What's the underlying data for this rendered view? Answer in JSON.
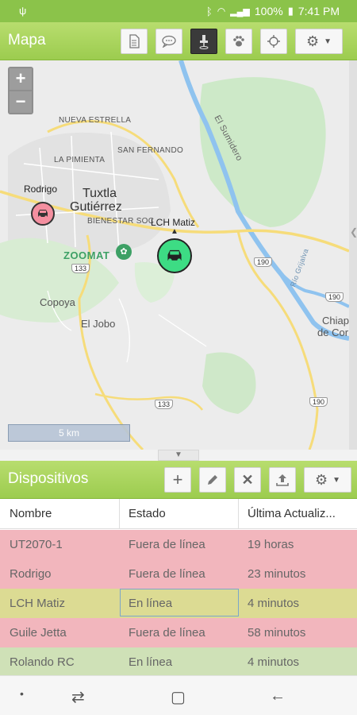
{
  "status_bar": {
    "left_icon": "usb-icon",
    "battery": "100%",
    "time": "7:41 PM",
    "right_icons": [
      "bluetooth-icon",
      "wifi-icon",
      "signal-icon",
      "battery-icon"
    ]
  },
  "map_panel": {
    "title": "Mapa",
    "toolbar": [
      {
        "name": "document-icon"
      },
      {
        "name": "chat-icon"
      },
      {
        "name": "pin-icon",
        "active": true
      },
      {
        "name": "paw-icon"
      },
      {
        "name": "target-icon"
      },
      {
        "name": "settings-dropdown",
        "glyph": "gear-icon"
      }
    ],
    "zoom_in": "+",
    "zoom_out": "−",
    "scale": "5 km"
  },
  "map": {
    "labels": {
      "nueva_estrella": "NUEVA ESTRELLA",
      "la_pimienta": "LA PIMIENTA",
      "san_fernando": "SAN FERNANDO",
      "el_sumidero": "El Sumidero",
      "rio_grijalva": "Río Grijalva",
      "tuxtla_1": "Tuxtla",
      "tuxtla_2": "Gutiérrez",
      "bienestar": "BIENESTAR SOC",
      "zoomat": "ZOOMAT",
      "copoya": "Copoya",
      "el_jobo": "El Jobo",
      "chiapa_1": "Chiap",
      "chiapa_2": "de Cor",
      "road_133a": "133",
      "road_133b": "133",
      "road_190a": "190",
      "road_190b": "190",
      "road_190c": "190"
    },
    "vehicles": [
      {
        "label": "Rodrigo",
        "status": "offline"
      },
      {
        "label": "LCH Matiz",
        "status": "online"
      }
    ]
  },
  "devices_panel": {
    "title": "Dispositivos",
    "toolbar": [
      "add-icon",
      "edit-icon",
      "delete-icon",
      "upload-icon",
      "settings-dropdown"
    ],
    "columns": [
      "Nombre",
      "Estado",
      "Última Actualiz..."
    ],
    "rows": [
      {
        "name": "UT2070-1",
        "state": "Fuera de línea",
        "updated": "19 horas",
        "status": "offline"
      },
      {
        "name": "Rodrigo",
        "state": "Fuera de línea",
        "updated": "23 minutos",
        "status": "offline"
      },
      {
        "name": "LCH Matiz",
        "state": "En línea",
        "updated": "4 minutos",
        "status": "online-selected"
      },
      {
        "name": "Guile Jetta",
        "state": "Fuera de línea",
        "updated": "58 minutos",
        "status": "offline"
      },
      {
        "name": "Rolando RC",
        "state": "En línea",
        "updated": "4 minutos",
        "status": "online"
      }
    ]
  },
  "colors": {
    "accent": "#9ccc4f",
    "offline_row": "#f2b6bd",
    "online_row": "#cfe1b7",
    "selected_row": "#dcdb93",
    "online_marker": "#3ddc84",
    "offline_marker": "#f48fa0"
  }
}
